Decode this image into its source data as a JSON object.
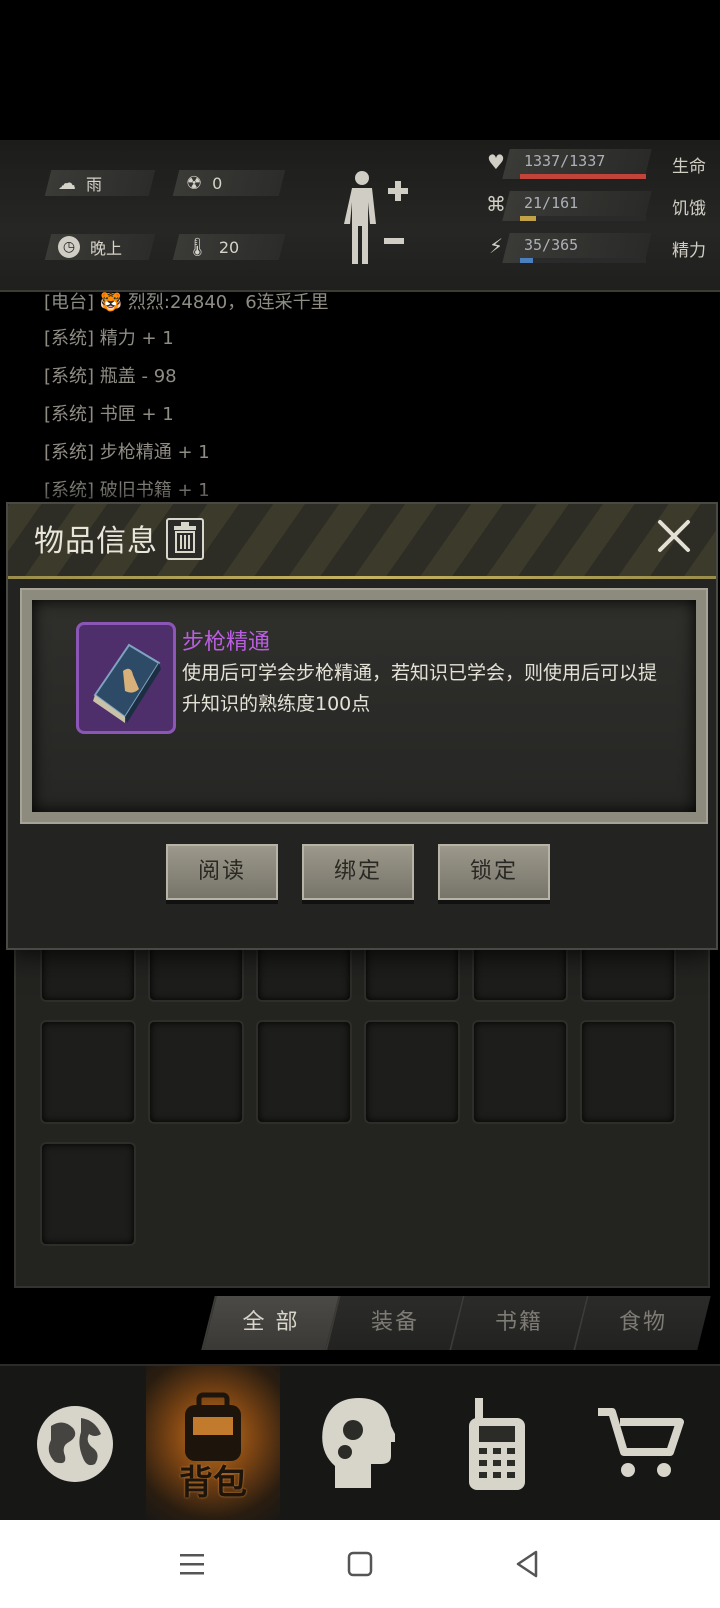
{
  "env": {
    "weather": "雨",
    "radiation": "0",
    "time_of_day": "晚上",
    "temperature": "20"
  },
  "stats": [
    {
      "value": "1337/1337",
      "name": "生命",
      "fill": 1.0,
      "color": "#c0443a"
    },
    {
      "value": "21/161",
      "name": "饥饿",
      "fill": 0.13,
      "color": "#c2a246"
    },
    {
      "value": "35/365",
      "name": "精力",
      "fill": 0.1,
      "color": "#4b7fc0"
    }
  ],
  "log": [
    "[电台] 🐯 烈烈:24840，6连采千里",
    "[系统] 精力 + 1",
    "[系统] 瓶盖 - 98",
    "[系统] 书匣 + 1",
    "[系统] 步枪精通 + 1",
    "[系统] 破旧书籍 + 1"
  ],
  "dialog": {
    "title": "物品信息",
    "item_name": "步枪精通",
    "item_desc": "使用后可学会步枪精通，若知识已学会，则使用后可以提升知识的熟练度100点",
    "buttons": {
      "read": "阅读",
      "bind": "绑定",
      "lock": "锁定"
    }
  },
  "tabs": [
    "全 部",
    "装备",
    "书籍",
    "食物"
  ],
  "nav": {
    "bag_label": "背包"
  },
  "icons": {
    "weather": "rain-cloud-icon",
    "radiation": "radiation-icon",
    "clock": "clock-icon",
    "thermometer": "thermometer-icon",
    "body": "body-figure-icon",
    "health": "heart-icon",
    "hunger": "stomach-icon",
    "energy": "energy-icon",
    "trash": "trash-icon",
    "close": "close-icon",
    "world": "globe-icon",
    "bag": "backpack-icon",
    "skills": "head-gears-icon",
    "radio": "walkie-talkie-icon",
    "shop": "cart-icon"
  }
}
